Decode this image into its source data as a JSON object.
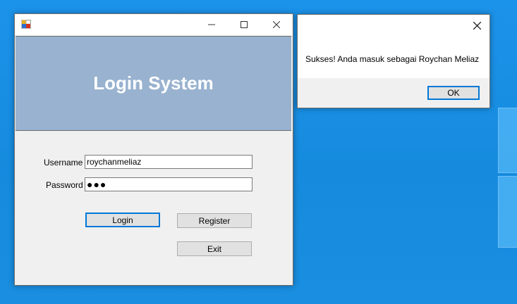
{
  "main_window": {
    "header_title": "Login System",
    "username_label": "Username",
    "username_value": "roychanmeliaz",
    "password_label": "Password",
    "password_masked": "●●●",
    "login_label": "Login",
    "register_label": "Register",
    "exit_label": "Exit"
  },
  "message_box": {
    "text": "Sukses! Anda masuk sebagai Roychan Meliaz",
    "ok_label": "OK"
  },
  "colors": {
    "desktop": "#1a8fe3",
    "header_panel": "#98b2cf",
    "focus_accent": "#0078d7"
  },
  "icons": [
    "app-icon",
    "minimize-icon",
    "maximize-icon",
    "close-icon"
  ]
}
